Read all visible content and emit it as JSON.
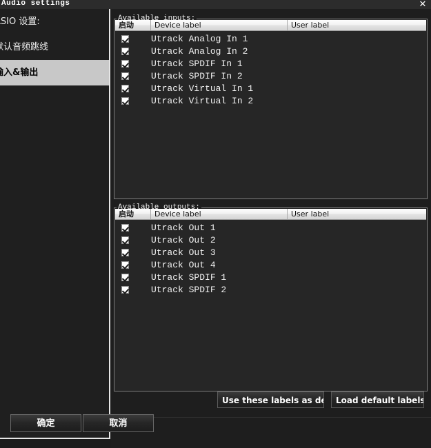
{
  "window": {
    "title": "Audio settings",
    "close_icon": "close-icon",
    "close_glyph": "✕"
  },
  "sidebar": {
    "items": [
      {
        "label": "ASIO 设置:",
        "selected": false
      },
      {
        "label": "默认音频跳线",
        "selected": false
      },
      {
        "label": "输入&输出",
        "selected": true
      }
    ]
  },
  "main": {
    "inputs": {
      "group_title": "Available inputs:",
      "columns": [
        "启动",
        "Device label",
        "User label"
      ],
      "rows": [
        {
          "enabled": true,
          "device_label": "Utrack Analog In 1",
          "user_label": ""
        },
        {
          "enabled": true,
          "device_label": "Utrack Analog In 2",
          "user_label": ""
        },
        {
          "enabled": true,
          "device_label": "Utrack SPDIF In 1",
          "user_label": ""
        },
        {
          "enabled": true,
          "device_label": "Utrack SPDIF In 2",
          "user_label": ""
        },
        {
          "enabled": true,
          "device_label": "Utrack Virtual In 1",
          "user_label": ""
        },
        {
          "enabled": true,
          "device_label": "Utrack Virtual In 2",
          "user_label": ""
        }
      ]
    },
    "outputs": {
      "group_title": "Available outputs:",
      "columns": [
        "启动",
        "Device label",
        "User label"
      ],
      "rows": [
        {
          "enabled": true,
          "device_label": "Utrack Out 1",
          "user_label": ""
        },
        {
          "enabled": true,
          "device_label": "Utrack Out 2",
          "user_label": ""
        },
        {
          "enabled": true,
          "device_label": "Utrack Out 3",
          "user_label": ""
        },
        {
          "enabled": true,
          "device_label": "Utrack Out 4",
          "user_label": ""
        },
        {
          "enabled": true,
          "device_label": "Utrack SPDIF 1",
          "user_label": ""
        },
        {
          "enabled": true,
          "device_label": "Utrack SPDIF 2",
          "user_label": ""
        }
      ]
    },
    "label_buttons": {
      "use_as_default": "Use these labels as default",
      "load_default": "Load default labels"
    },
    "dialog_buttons": {
      "ok": "确定",
      "cancel": "取消"
    }
  },
  "colors": {
    "window_bg": "#1e1e1e",
    "titlebar_bg": "#2c2c2c",
    "sidebar_bg": "#1f1f1f",
    "selection_bg": "#c8c8c8",
    "header_bg": "#f2f2f2",
    "border": "#7e7e7e",
    "text": "#f2f2f2"
  }
}
